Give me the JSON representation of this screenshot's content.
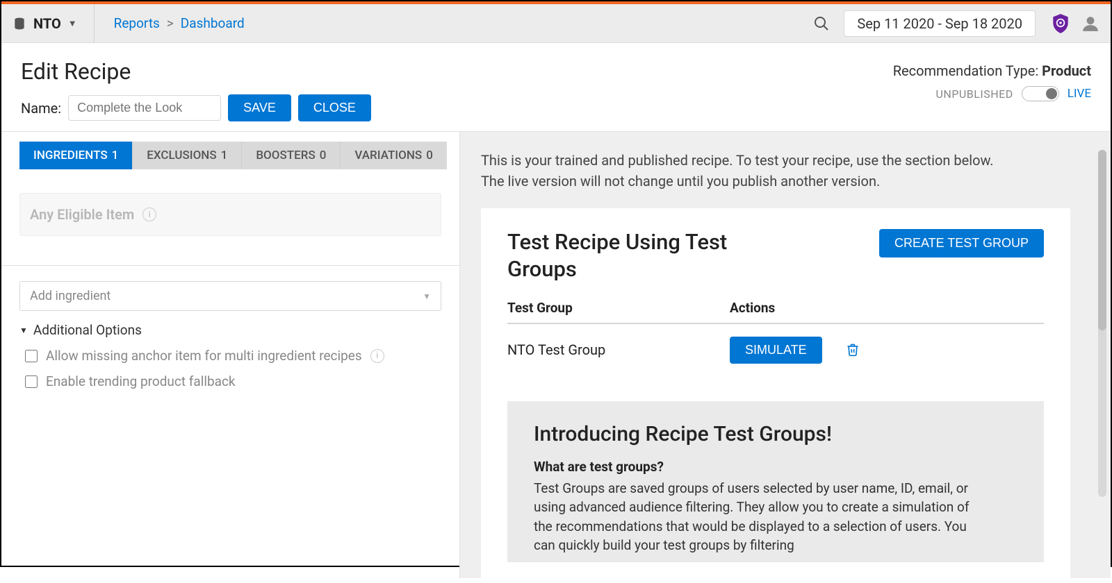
{
  "topbar": {
    "org_name": "NTO",
    "breadcrumb": {
      "first": "Reports",
      "second": "Dashboard"
    },
    "date_range": "Sep 11 2020 - Sep 18 2020"
  },
  "header": {
    "page_title": "Edit Recipe",
    "name_label": "Name:",
    "name_placeholder": "Complete the Look",
    "save_label": "SAVE",
    "close_label": "CLOSE",
    "rec_type_label": "Recommendation Type: ",
    "rec_type_value": "Product",
    "unpublished_label": "UNPUBLISHED",
    "live_label": "LIVE"
  },
  "tabs": [
    {
      "label": "INGREDIENTS",
      "count": "1",
      "active": true
    },
    {
      "label": "EXCLUSIONS",
      "count": "1",
      "active": false
    },
    {
      "label": "BOOSTERS",
      "count": "0",
      "active": false
    },
    {
      "label": "VARIATIONS",
      "count": "0",
      "active": false
    }
  ],
  "left": {
    "eligible_label": "Any Eligible Item",
    "add_ingredient_placeholder": "Add ingredient",
    "additional_options_label": "Additional Options",
    "option_missing_anchor": "Allow missing anchor item for multi ingredient recipes",
    "option_trending_fallback": "Enable trending product fallback"
  },
  "right": {
    "intro": "This is your trained and published recipe. To test your recipe, use the section below. The live version will not change until you publish another version.",
    "test_title": "Test Recipe Using Test Groups",
    "create_group_label": "CREATE TEST GROUP",
    "col_group": "Test Group",
    "col_actions": "Actions",
    "row_name": "NTO Test Group",
    "simulate_label": "SIMULATE",
    "promo_title": "Introducing Recipe Test Groups!",
    "promo_sub": "What are test groups?",
    "promo_body": "Test Groups are saved groups of users selected by user name, ID, email, or using advanced audience filtering. They allow you to create a simulation of the recommendations that would be displayed to a selection of users. You can quickly build your test groups by filtering"
  }
}
